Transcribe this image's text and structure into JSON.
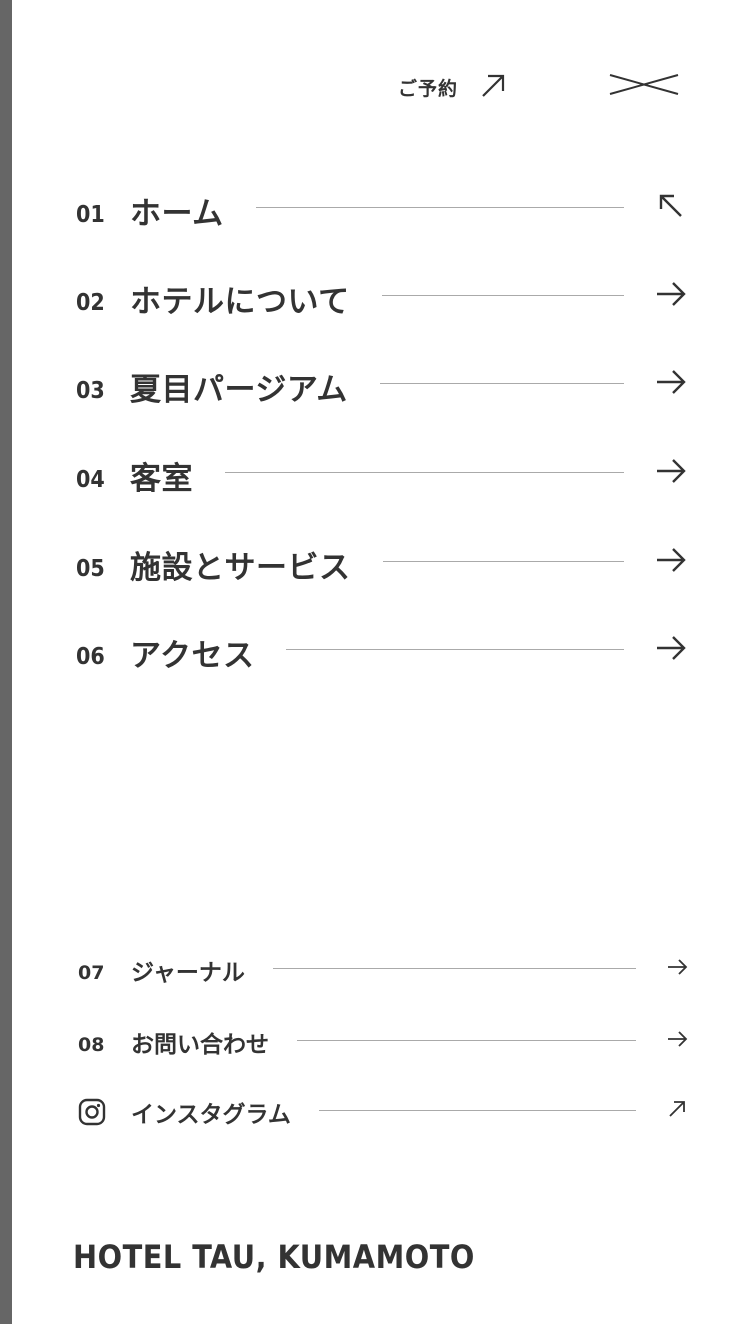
{
  "header": {
    "reserve_label": "ご予約",
    "reserve_icon": "arrow-up-right-icon",
    "close_icon": "close-icon"
  },
  "main_nav": [
    {
      "num": "01",
      "label": "ホーム",
      "icon": "arrow-up-left-icon"
    },
    {
      "num": "02",
      "label": "ホテルについて",
      "icon": "arrow-right-icon"
    },
    {
      "num": "03",
      "label": "夏目パージアム",
      "icon": "arrow-right-icon"
    },
    {
      "num": "04",
      "label": "客室",
      "icon": "arrow-right-icon"
    },
    {
      "num": "05",
      "label": "施設とサービス",
      "icon": "arrow-right-icon"
    },
    {
      "num": "06",
      "label": "アクセス",
      "icon": "arrow-right-icon"
    }
  ],
  "sub_nav": [
    {
      "num": "07",
      "label": "ジャーナル",
      "icon": "arrow-right-icon"
    },
    {
      "num": "08",
      "label": "お問い合わせ",
      "icon": "arrow-right-icon"
    },
    {
      "label": "インスタグラム",
      "leading_icon": "instagram-icon",
      "icon": "arrow-up-right-icon"
    }
  ],
  "footer": {
    "brand": "HOTEL TAU, KUMAMOTO"
  },
  "colors": {
    "text": "#333333",
    "divider": "#aaaaaa",
    "strip": "#666666",
    "background": "#ffffff"
  }
}
